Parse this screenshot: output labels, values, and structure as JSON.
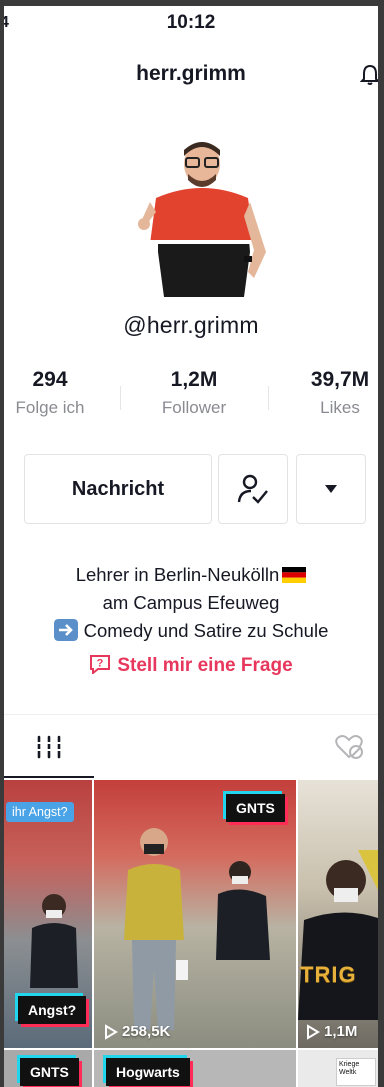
{
  "status_bar": {
    "time": "10:12",
    "left_edge_char": "4"
  },
  "header": {
    "title": "herr.grimm",
    "bell_icon": "bell-icon"
  },
  "profile": {
    "handle": "@herr.grimm"
  },
  "stats": [
    {
      "value": "294",
      "label": "Folge ich"
    },
    {
      "value": "1,2M",
      "label": "Follower"
    },
    {
      "value": "39,7M",
      "label": "Likes"
    }
  ],
  "actions": {
    "message_label": "Nachricht",
    "follow_icon": "followed-user-icon",
    "more_icon": "caret-down-icon"
  },
  "bio": {
    "line1": "Lehrer in Berlin-Neukölln",
    "line2": "am Campus Efeuweg",
    "line3": "Comedy und Satire zu Schule"
  },
  "question_link": "Stell mir eine Frage",
  "tabs": {
    "videos_icon": "grid-icon",
    "liked_icon": "liked-hidden-icon"
  },
  "videos": [
    {
      "tag": "ihr Angst?",
      "label": "Angst?"
    },
    {
      "label": "GNTS",
      "views": "258,5K"
    },
    {
      "overlay_text": "TRIG",
      "views": "1,1M"
    },
    {
      "label": "GNTS"
    },
    {
      "label": "Hogwarts"
    },
    {
      "tag": "Kriege Weltk"
    }
  ],
  "colors": {
    "accent": "#e8375c",
    "text": "#161823",
    "muted": "#8a8b91"
  }
}
